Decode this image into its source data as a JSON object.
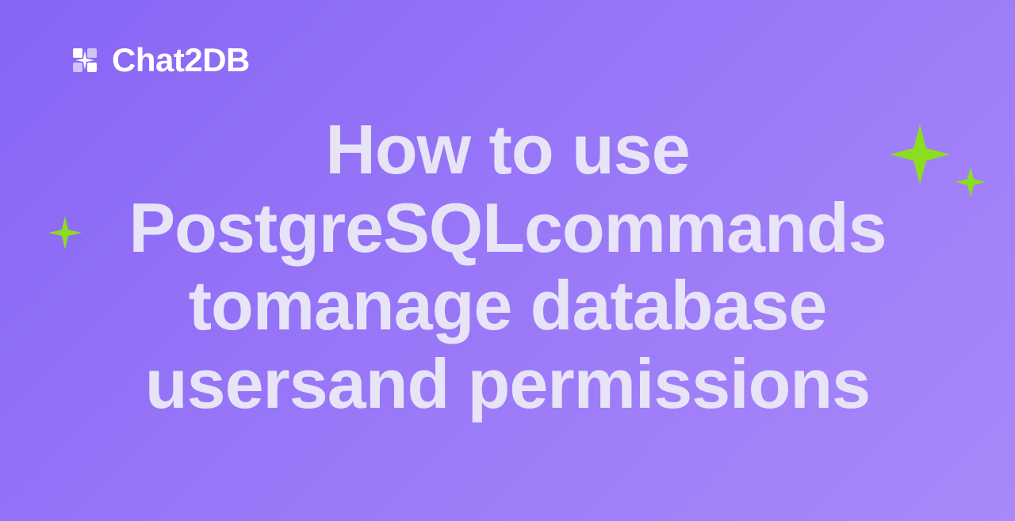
{
  "logo": {
    "text": "Chat2DB"
  },
  "title": {
    "line1": "How to use",
    "line2": "PostgreSQLcommands",
    "line3": "tomanage database",
    "line4": "usersand permissions"
  },
  "colors": {
    "sparkle": "#8bdd1f",
    "text_main": "#e8e4f8",
    "text_logo": "#ffffff"
  }
}
